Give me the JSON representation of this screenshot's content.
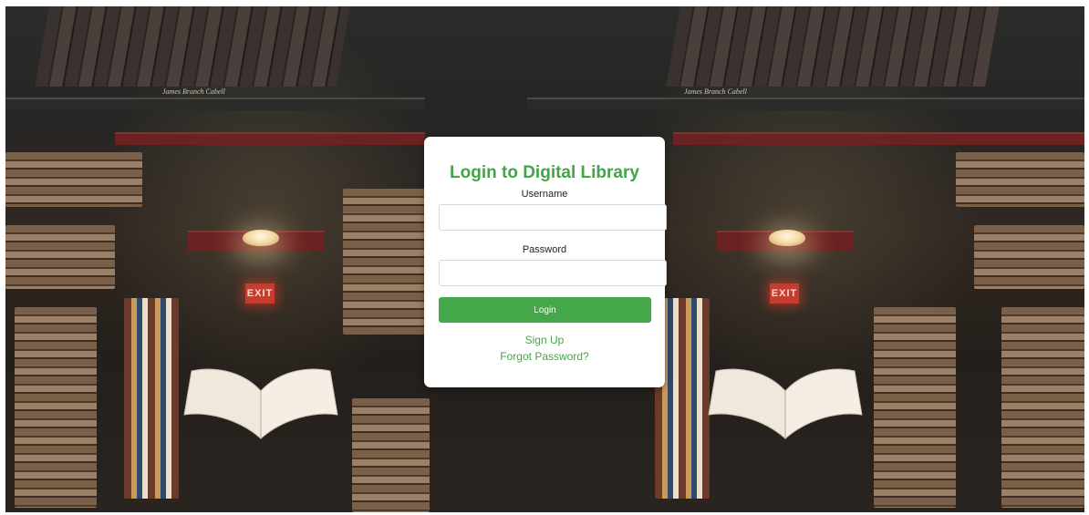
{
  "login": {
    "title": "Login to Digital Library",
    "username_label": "Username",
    "username_value": "",
    "password_label": "Password",
    "password_value": "",
    "login_button": "Login",
    "signup_link": "Sign Up",
    "forgot_link": "Forgot Password?"
  },
  "background": {
    "caption": "James Branch Cabell",
    "exit_sign": "EXIT"
  },
  "colors": {
    "accent": "#43a548",
    "card": "#ffffff",
    "background_dark": "#1e2120"
  }
}
